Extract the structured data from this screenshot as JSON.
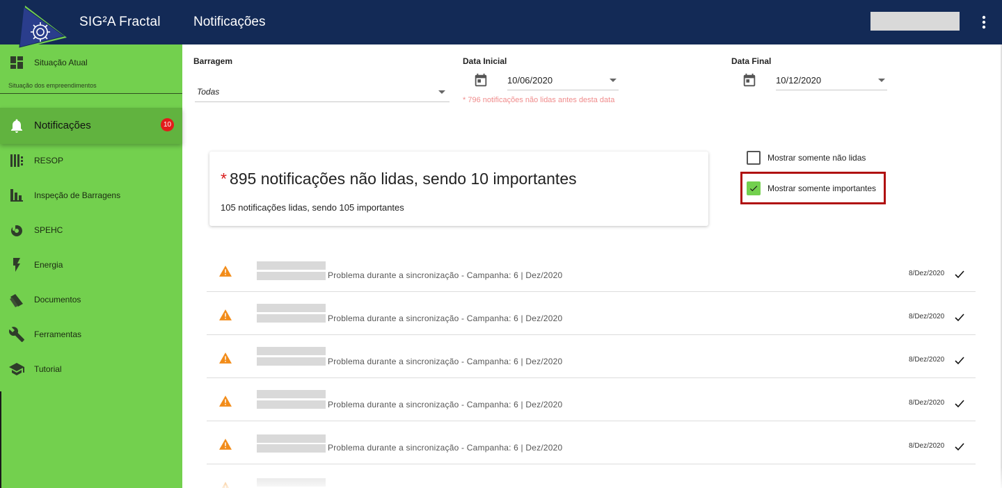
{
  "header": {
    "app_title": "SIG²A Fractal",
    "page_title": "Notificações",
    "brand_color": "#132a56"
  },
  "sidebar": {
    "accent_color": "#73d04e",
    "items": [
      {
        "label": "Situação Atual",
        "icon": "dashboard-icon"
      },
      {
        "label": "Notificações",
        "icon": "bell-icon",
        "badge": "10",
        "active": true
      },
      {
        "label": "RESOP",
        "icon": "resop-icon"
      },
      {
        "label": "Inspeção de Barragens",
        "icon": "inspection-icon"
      },
      {
        "label": "SPEHC",
        "icon": "spehc-icon"
      },
      {
        "label": "Energia",
        "icon": "lightning-icon"
      },
      {
        "label": "Documentos",
        "icon": "documents-icon"
      },
      {
        "label": "Ferramentas",
        "icon": "wrench-icon"
      },
      {
        "label": "Tutorial",
        "icon": "graduation-cap-icon"
      }
    ],
    "subtitle": "Situação dos empreendimentos"
  },
  "filters": {
    "barragem_label": "Barragem",
    "barragem_value": "Todas",
    "data_inicial_label": "Data Inicial",
    "data_inicial_value": "10/06/2020",
    "data_final_label": "Data Final",
    "data_final_value": "10/12/2020",
    "hint": "* 796 notificações não lidas antes desta data"
  },
  "summary": {
    "star": "*",
    "headline": "895 notificações não lidas, sendo 10 importantes",
    "subline": "105 notificações lidas, sendo 105 importantes"
  },
  "options": {
    "only_unread_label": "Mostrar somente não lidas",
    "only_unread_checked": false,
    "only_important_label": "Mostrar somente importantes",
    "only_important_checked": true
  },
  "notifications": [
    {
      "text": "Problema durante a sincronização - Campanha: 6 | Dez/2020",
      "date": "8/Dez/2020"
    },
    {
      "text": "Problema durante a sincronização - Campanha: 6 | Dez/2020",
      "date": "8/Dez/2020"
    },
    {
      "text": "Problema durante a sincronização - Campanha: 6 | Dez/2020",
      "date": "8/Dez/2020"
    },
    {
      "text": "Problema durante a sincronização - Campanha: 6 | Dez/2020",
      "date": "8/Dez/2020"
    },
    {
      "text": "Problema durante a sincronização - Campanha: 6 | Dez/2020",
      "date": "8/Dez/2020"
    }
  ]
}
